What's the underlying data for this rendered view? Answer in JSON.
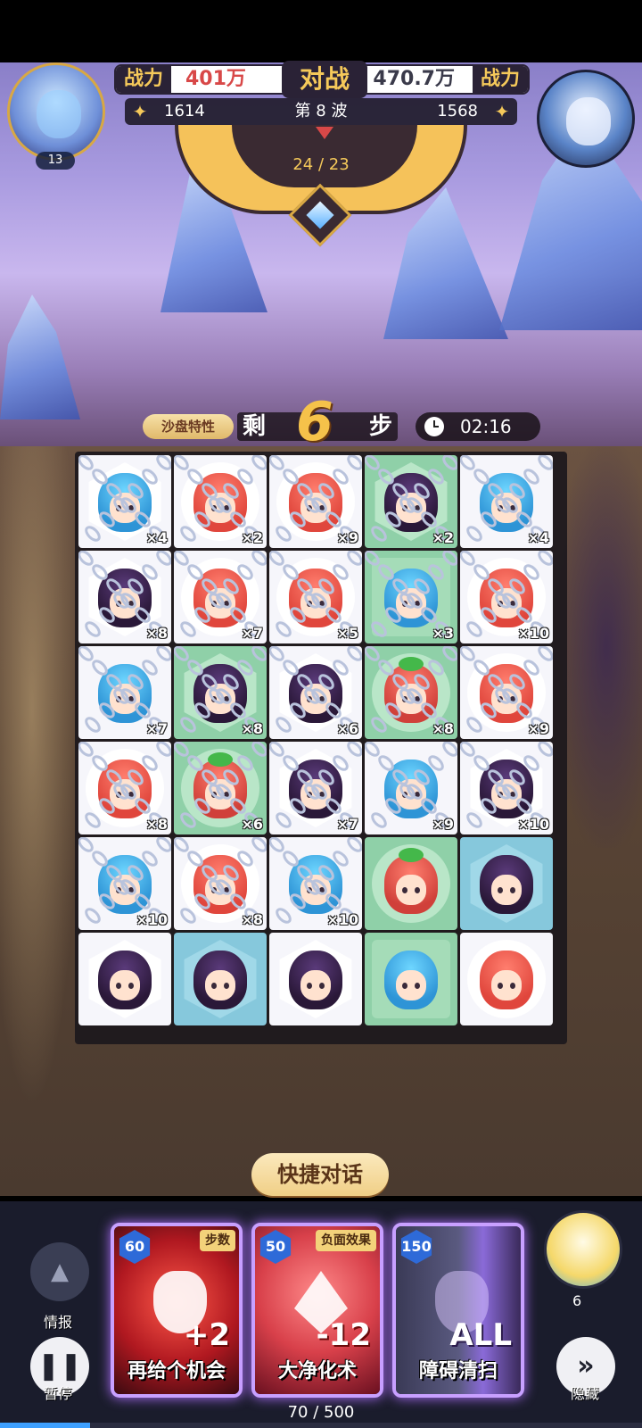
{
  "hud": {
    "power_label": "战力",
    "vs_label": "对战",
    "player": {
      "power": "401万",
      "score": "1614",
      "level": "13"
    },
    "enemy": {
      "power": "470.7万",
      "score": "1568"
    },
    "wave": "第 8 波",
    "progress": "24 / 23"
  },
  "moves": {
    "trait_label": "沙盘特性",
    "prefix": "剩",
    "count": "6",
    "suffix": "步",
    "timer": "02:16"
  },
  "board": {
    "rows": [
      [
        {
          "hero": "blue",
          "tile": "white",
          "shape": "hex",
          "chain": "×4"
        },
        {
          "hero": "red",
          "tile": "white",
          "shape": "circle",
          "chain": "×2"
        },
        {
          "hero": "red",
          "tile": "white",
          "shape": "circle",
          "chain": "×9"
        },
        {
          "hero": "purple",
          "tile": "green",
          "shape": "hex",
          "chain": "×2"
        },
        {
          "hero": "blue",
          "tile": "white",
          "shape": "square",
          "chain": "×4"
        }
      ],
      [
        {
          "hero": "purple",
          "tile": "white",
          "shape": "hex",
          "chain": "×8"
        },
        {
          "hero": "red",
          "tile": "white",
          "shape": "circle",
          "chain": "×7"
        },
        {
          "hero": "red",
          "tile": "white",
          "shape": "circle",
          "chain": "×5"
        },
        {
          "hero": "blue",
          "tile": "green",
          "shape": "square",
          "chain": "×3"
        },
        {
          "hero": "red",
          "tile": "white",
          "shape": "circle",
          "chain": "×10"
        }
      ],
      [
        {
          "hero": "blue",
          "tile": "white",
          "shape": "square",
          "chain": "×7"
        },
        {
          "hero": "purple",
          "tile": "green",
          "shape": "hex",
          "chain": "×8"
        },
        {
          "hero": "purple",
          "tile": "white",
          "shape": "hex",
          "chain": "×6"
        },
        {
          "hero": "green",
          "tile": "green",
          "shape": "circle",
          "chain": "×8"
        },
        {
          "hero": "red",
          "tile": "white",
          "shape": "circle",
          "chain": "×9"
        }
      ],
      [
        {
          "hero": "red",
          "tile": "white",
          "shape": "circle",
          "chain": "×8"
        },
        {
          "hero": "green",
          "tile": "green",
          "shape": "circle",
          "chain": "×6"
        },
        {
          "hero": "purple",
          "tile": "white",
          "shape": "hex",
          "chain": "×7"
        },
        {
          "hero": "blue",
          "tile": "white",
          "shape": "square",
          "chain": "×9"
        },
        {
          "hero": "purple",
          "tile": "white",
          "shape": "hex",
          "chain": "×10"
        }
      ],
      [
        {
          "hero": "blue",
          "tile": "white",
          "shape": "square",
          "chain": "×10"
        },
        {
          "hero": "red",
          "tile": "white",
          "shape": "circle",
          "chain": "×8"
        },
        {
          "hero": "blue",
          "tile": "white",
          "shape": "square",
          "chain": "×10"
        },
        {
          "hero": "green",
          "tile": "green",
          "shape": "circle",
          "chain": ""
        },
        {
          "hero": "purple",
          "tile": "blue",
          "shape": "hex",
          "chain": ""
        }
      ],
      [
        {
          "hero": "purple",
          "tile": "white",
          "shape": "hex",
          "chain": ""
        },
        {
          "hero": "purple",
          "tile": "blue",
          "shape": "hex",
          "chain": ""
        },
        {
          "hero": "purple",
          "tile": "white",
          "shape": "hex",
          "chain": ""
        },
        {
          "hero": "blue",
          "tile": "green",
          "shape": "square",
          "chain": ""
        },
        {
          "hero": "red",
          "tile": "white",
          "shape": "circle",
          "chain": ""
        }
      ]
    ]
  },
  "quick_chat": "快捷对话",
  "controls": {
    "info_label": "情报",
    "pause_label": "暂停",
    "hide_label": "隐藏",
    "companion_count": "6"
  },
  "skills": [
    {
      "cost": "60",
      "tag": "步数",
      "effect": "+2",
      "name": "再给个机会"
    },
    {
      "cost": "50",
      "tag": "负面效果",
      "effect": "-12",
      "name": "大净化术"
    },
    {
      "cost": "150",
      "tag": "",
      "effect": "ALL",
      "name": "障碍清扫"
    }
  ],
  "energy": {
    "text": "70 / 500",
    "current": 70,
    "max": 500
  },
  "colors": {
    "accent_gold": "#f5c95a",
    "power_red": "#d84848",
    "card_glow": "#c8a0ff",
    "energy_blue": "#3ea0ff"
  }
}
